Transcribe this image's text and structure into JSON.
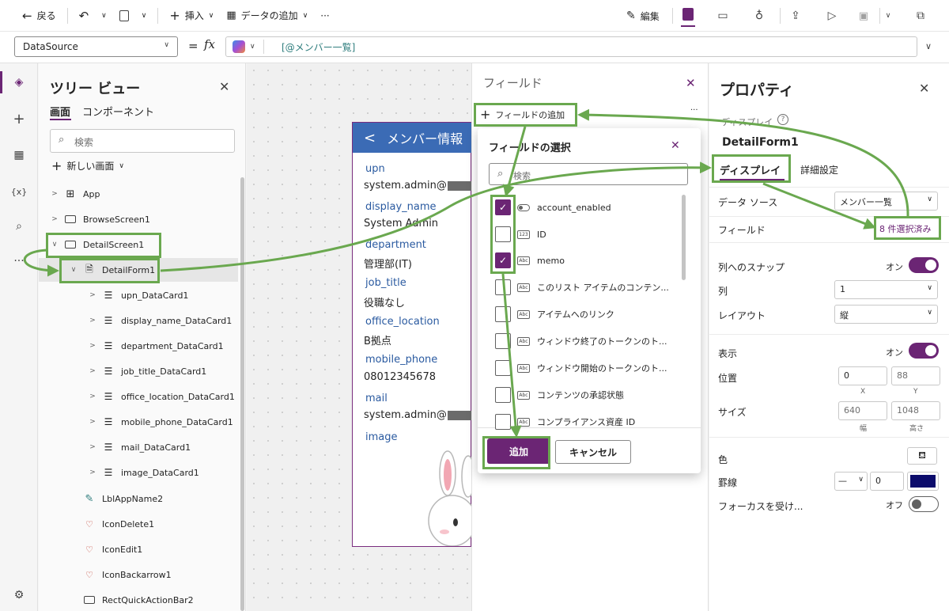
{
  "toolbar": {
    "back": "戻る",
    "insert": "挿入",
    "add_data": "データの追加",
    "more": "···",
    "edit": "編集"
  },
  "formula": {
    "property": "DataSource",
    "equals": "=",
    "fx": "fx",
    "value": "[@メンバー一覧]"
  },
  "tree": {
    "title": "ツリー ビュー",
    "tabs": [
      "画面",
      "コンポーネント"
    ],
    "search_placeholder": "検索",
    "new_screen": "新しい画面",
    "items": [
      "App",
      "BrowseScreen1",
      "DetailScreen1",
      "DetailForm1",
      "upn_DataCard1",
      "display_name_DataCard1",
      "department_DataCard1",
      "job_title_DataCard1",
      "office_location_DataCard1",
      "mobile_phone_DataCard1",
      "mail_DataCard1",
      "image_DataCard1",
      "LblAppName2",
      "IconDelete1",
      "IconEdit1",
      "IconBackarrow1",
      "RectQuickActionBar2"
    ]
  },
  "form": {
    "header": "メンバー情報",
    "fields": [
      {
        "label": "upn",
        "value": "system.admin@"
      },
      {
        "label": "display_name",
        "value": "System Admin"
      },
      {
        "label": "department",
        "value": "管理部(IT)"
      },
      {
        "label": "job_title",
        "value": "役職なし"
      },
      {
        "label": "office_location",
        "value": "B拠点"
      },
      {
        "label": "mobile_phone",
        "value": "08012345678"
      },
      {
        "label": "mail",
        "value": "system.admin@"
      },
      {
        "label": "image",
        "value": ""
      }
    ]
  },
  "fields_pane": {
    "title": "フィールド",
    "add_field": "フィールドの追加",
    "more": "···"
  },
  "picker": {
    "title": "フィールドの選択",
    "search_placeholder": "検索",
    "items": [
      {
        "label": "account_enabled",
        "type": "toggle",
        "checked": true
      },
      {
        "label": "ID",
        "type": "123",
        "checked": false
      },
      {
        "label": "memo",
        "type": "Abc",
        "checked": true
      },
      {
        "label": "このリスト アイテムのコンテン...",
        "type": "Abc",
        "checked": false
      },
      {
        "label": "アイテムへのリンク",
        "type": "Abc",
        "checked": false
      },
      {
        "label": "ウィンドウ終了のトークンのト...",
        "type": "Abc",
        "checked": false
      },
      {
        "label": "ウィンドウ開始のトークンのト...",
        "type": "Abc",
        "checked": false
      },
      {
        "label": "コンテンツの承認状態",
        "type": "Abc",
        "checked": false
      },
      {
        "label": "コンプライアンス資産 ID",
        "type": "Abc",
        "checked": false
      }
    ],
    "add_button": "追加",
    "cancel_button": "キャンセル"
  },
  "props": {
    "title": "プロパティ",
    "type_label": "ディスプレイ",
    "control_name": "DetailForm1",
    "tabs": [
      "ディスプレイ",
      "詳細設定"
    ],
    "datasource_label": "データ ソース",
    "datasource_value": "メンバー一覧",
    "fields_label": "フィールド",
    "fields_value": "8 件選択済み",
    "snap_label": "列へのスナップ",
    "snap_state": "オン",
    "columns_label": "列",
    "columns_value": "1",
    "layout_label": "レイアウト",
    "layout_value": "縦",
    "visible_label": "表示",
    "visible_state": "オン",
    "position_label": "位置",
    "pos_x": "0",
    "pos_y": "88",
    "x_caption": "X",
    "y_caption": "Y",
    "size_label": "サイズ",
    "width": "640",
    "height": "1048",
    "w_caption": "幅",
    "h_caption": "高さ",
    "color_label": "色",
    "border_label": "罫線",
    "border_width": "0",
    "border_color": "#0b0b6b",
    "focus_label": "フォーカスを受け...",
    "focus_state": "オフ"
  },
  "colors": {
    "accent": "#6b2574",
    "highlight": "#6aa84f",
    "form_header": "#3b6bb5"
  }
}
